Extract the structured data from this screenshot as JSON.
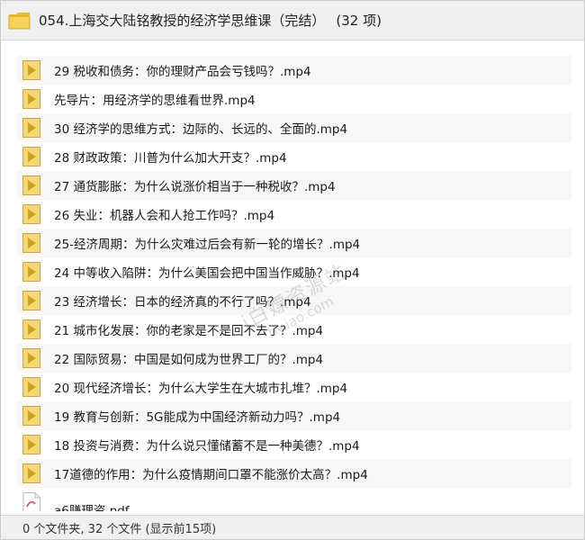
{
  "window": {
    "title": "054.上海交大陆铭教授的经济学思维课（完结）",
    "count": "(32 项)"
  },
  "files": [
    {
      "name": "29 税收和债务：你的理财产品会亏钱吗？.mp4",
      "icon": "media-play-icon"
    },
    {
      "name": "先导片：用经济学的思维看世界.mp4",
      "icon": "media-play-icon"
    },
    {
      "name": "30 经济学的思维方式：边际的、长远的、全面的.mp4",
      "icon": "media-play-icon"
    },
    {
      "name": "28 财政政策：川普为什么加大开支？.mp4",
      "icon": "media-play-icon"
    },
    {
      "name": "27 通货膨胀：为什么说涨价相当于一种税收？.mp4",
      "icon": "media-play-icon"
    },
    {
      "name": "26 失业：机器人会和人抢工作吗？.mp4",
      "icon": "media-play-icon"
    },
    {
      "name": "25-经济周期：为什么灾难过后会有新一轮的增长？.mp4",
      "icon": "media-play-icon"
    },
    {
      "name": "24 中等收入陷阱：为什么美国会把中国当作威胁？.mp4",
      "icon": "media-play-icon"
    },
    {
      "name": "23 经济增长：日本的经济真的不行了吗？.mp4",
      "icon": "media-play-icon"
    },
    {
      "name": "21 城市化发展：你的老家是不是回不去了？.mp4",
      "icon": "media-play-icon"
    },
    {
      "name": "22 国际贸易：中国是如何成为世界工厂的？.mp4",
      "icon": "media-play-icon"
    },
    {
      "name": "20 现代经济增长：为什么大学生在大城市扎堆？.mp4",
      "icon": "media-play-icon"
    },
    {
      "name": "19 教育与创新：5G能成为中国经济新动力吗？.mp4",
      "icon": "media-play-icon"
    },
    {
      "name": "18 投资与消费：为什么说只懂储蓄不是一种美德？.mp4",
      "icon": "media-play-icon"
    },
    {
      "name": "17道德的作用：为什么疫情期间口罩不能涨价太高？.mp4",
      "icon": "media-play-icon"
    },
    {
      "name": "a6赚理资.pdf",
      "icon": "pdf-icon"
    }
  ],
  "watermark": {
    "line1": "i白嫖资源站",
    "line2": "by.iao.com"
  },
  "status": {
    "text": "0 个文件夹, 32 个文件 (显示前15项)"
  },
  "colors": {
    "folder": "#f6d15a",
    "play_icon_bg": "#f5d776",
    "play_icon_arrow": "#c8a223"
  }
}
